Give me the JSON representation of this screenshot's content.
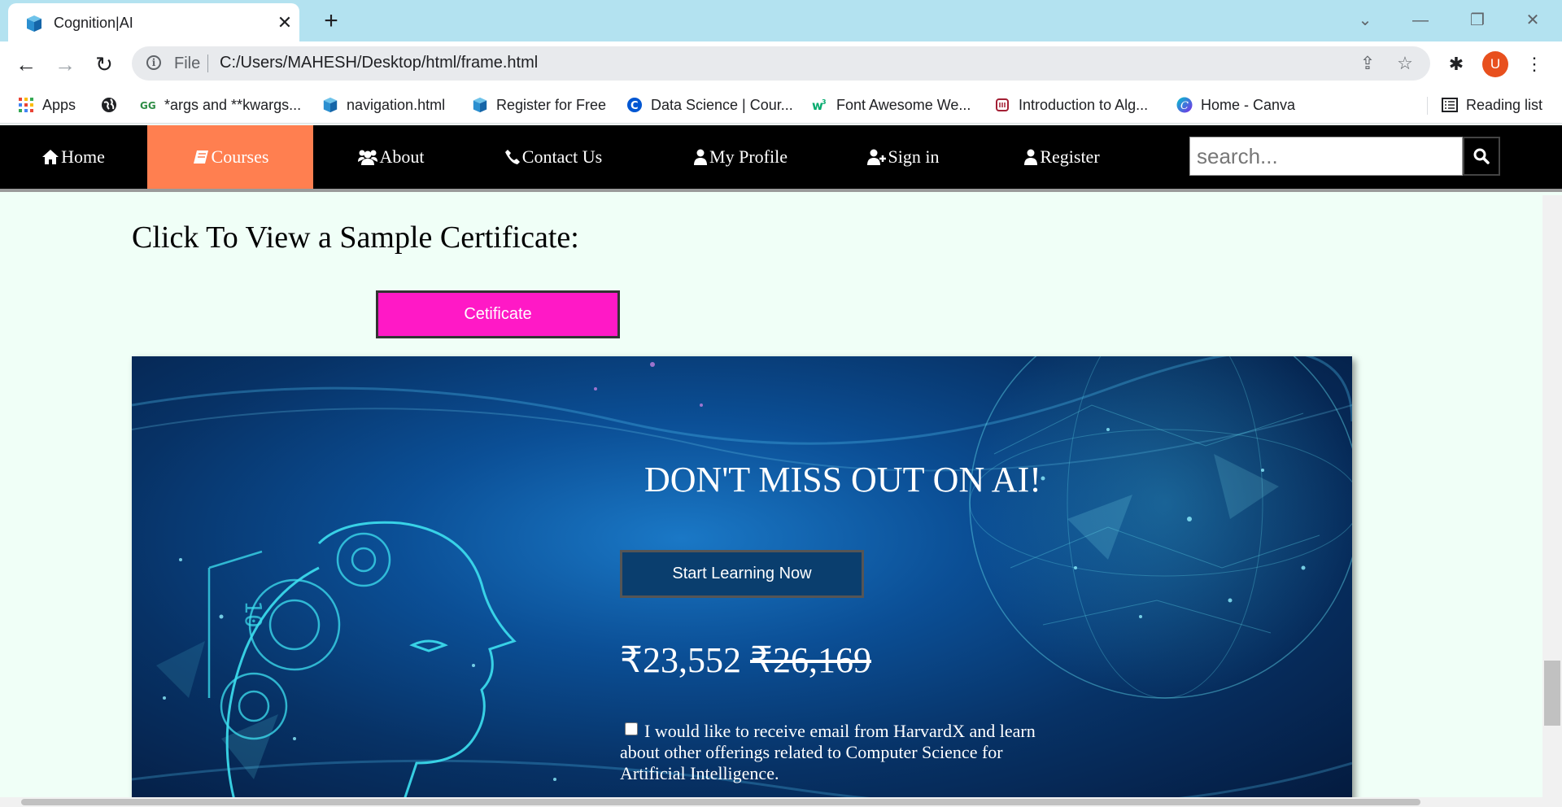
{
  "browser": {
    "tab_title": "Cognition|AI",
    "scheme_label": "File",
    "url": "C:/Users/MAHESH/Desktop/html/frame.html",
    "avatar_letter": "U",
    "bookmarks": [
      {
        "label": "Apps",
        "icon": "apps-grid-icon"
      },
      {
        "label": "",
        "icon": "globe-icon"
      },
      {
        "label": "*args and **kwargs...",
        "icon": "geeksforgeeks-icon"
      },
      {
        "label": "navigation.html",
        "icon": "cube-icon"
      },
      {
        "label": "Register for Free",
        "icon": "cube-icon"
      },
      {
        "label": "Data Science | Cour...",
        "icon": "coursera-icon"
      },
      {
        "label": "Font Awesome We...",
        "icon": "w3schools-icon"
      },
      {
        "label": "Introduction to Alg...",
        "icon": "mit-icon"
      },
      {
        "label": "Home - Canva",
        "icon": "canva-icon"
      }
    ],
    "reading_list": "Reading list"
  },
  "nav": {
    "items": [
      {
        "label": "Home",
        "icon": "home-icon"
      },
      {
        "label": " Courses",
        "icon": "book-icon"
      },
      {
        "label": "About",
        "icon": "users-icon"
      },
      {
        "label": "Contact Us",
        "icon": "phone-icon"
      },
      {
        "label": "My Profile",
        "icon": "user-icon"
      },
      {
        "label": "Sign in",
        "icon": "user-plus-icon"
      },
      {
        "label": "Register",
        "icon": "user-icon"
      }
    ],
    "active_item": "Courses",
    "search_placeholder": "search..."
  },
  "main": {
    "certificate_heading": "Click To View a Sample Certificate:",
    "certificate_button": "Cetificate",
    "banner": {
      "title": "DON'T MISS OUT ON AI!",
      "cta_button": "Start Learning Now",
      "price_current": "₹23,552",
      "price_original": "₹26,169",
      "consent_text": "I would like to receive email from HarvardX and learn about other offerings related to Computer Science for Artificial Intelligence."
    }
  },
  "colors": {
    "nav_background": "#000000",
    "nav_active": "#ff7f50",
    "certificate_button": "#ff19c6",
    "page_background": "#f0fff7",
    "tabstrip": "#b3e2f0"
  }
}
